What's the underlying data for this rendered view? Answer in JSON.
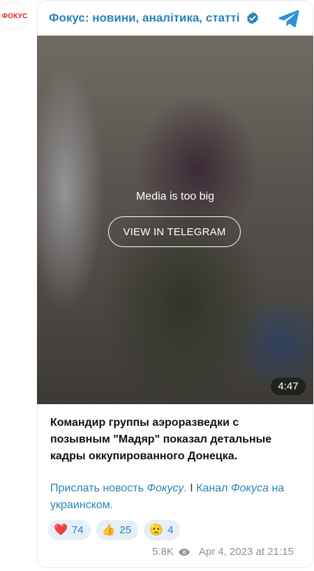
{
  "channel": {
    "avatar_text": "ФОКУС",
    "title": "Фокус: новини, аналітика, статті"
  },
  "media": {
    "overlay_text": "Media is too big",
    "view_button": "VIEW IN TELEGRAM",
    "duration": "4:47"
  },
  "post": {
    "text": "Командир группы аэроразведки с позывным \"Мадяр\" показал детальные кадры оккупированного Донецка.",
    "link1_plain": "Прислать новость ",
    "link1_italic": "Фокусу",
    "link1_end": ".",
    "separator": " I ",
    "link2_plain": "Канал ",
    "link2_italic": "Фокуса",
    "link2_end": " на украинском."
  },
  "reactions": [
    {
      "emoji": "❤️",
      "count": "74"
    },
    {
      "emoji": "👍",
      "count": "25"
    },
    {
      "emoji": "🫡",
      "count": "4"
    }
  ],
  "footer": {
    "views": "5.8K",
    "date": "Apr 4, 2023 at 21:15"
  },
  "colors": {
    "accent": "#2a83b8",
    "brand_red": "#e3232c",
    "reaction_bg": "#e6eef8"
  }
}
